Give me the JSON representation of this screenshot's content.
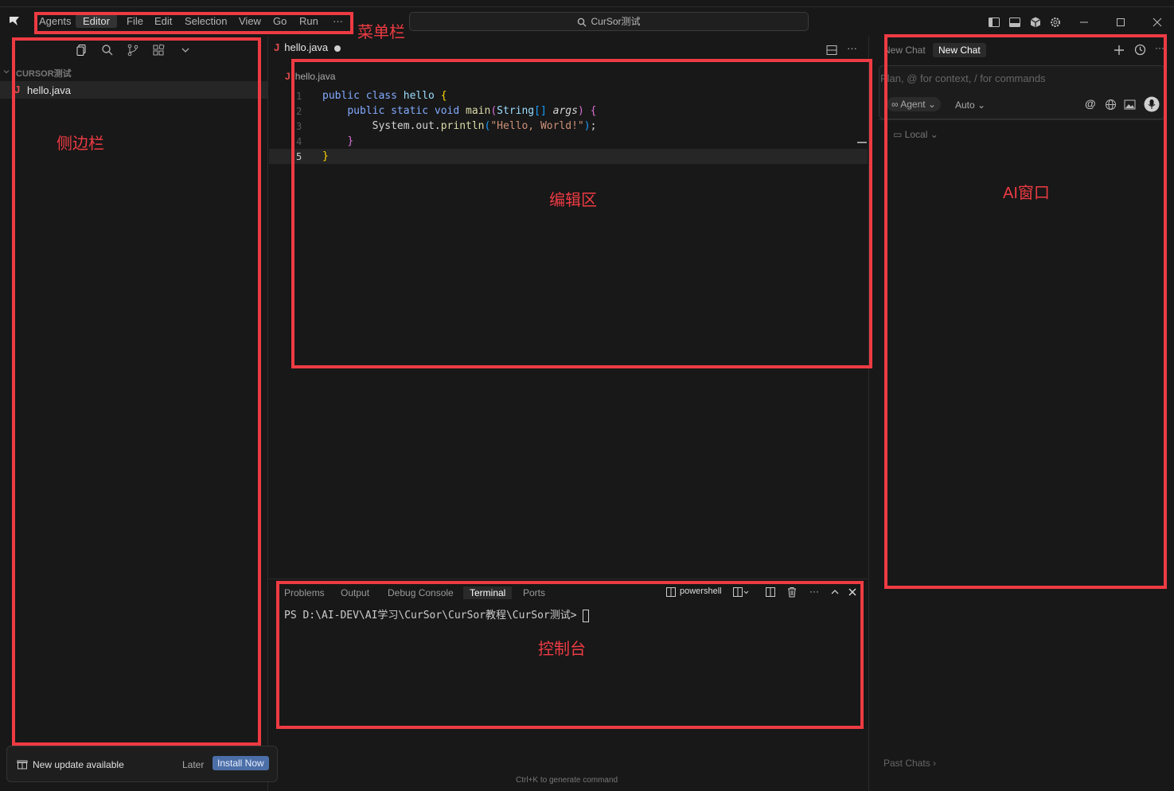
{
  "titlebar": {
    "menu": [
      "Agents",
      "Editor",
      "File",
      "Edit",
      "Selection",
      "View",
      "Go",
      "Run"
    ],
    "more": "···",
    "search_text": "CurSor测试"
  },
  "sidebar": {
    "explorer_title": "CURSOR测试",
    "file_icon_glyph": "J",
    "file_name": "hello.java"
  },
  "editor": {
    "tab_label": "hello.java",
    "breadcrumb": "hello.java",
    "line_numbers": [
      "1",
      "2",
      "3",
      "4",
      "5"
    ]
  },
  "panel": {
    "tabs": [
      "Problems",
      "Output",
      "Debug Console",
      "Terminal",
      "Ports"
    ],
    "shell": "powershell",
    "terminal_prompt": "PS D:\\AI-DEV\\AI学习\\CurSor\\CurSor教程\\CurSor测试> ",
    "hint": "Ctrl+K to generate command"
  },
  "ai": {
    "tab1": "New Chat",
    "tab2": "New Chat",
    "placeholder": "Plan, @ for context, / for commands",
    "agent_label": "Agent",
    "auto_label": "Auto",
    "local_label": "Local",
    "past_chats": "Past Chats"
  },
  "notification": {
    "text": "New update available",
    "later": "Later",
    "install": "Install Now"
  },
  "annotations": {
    "menubar": "菜单栏",
    "sidebar": "侧边栏",
    "editor": "编辑区",
    "ai": "AI窗口",
    "console": "控制台"
  },
  "colors": {
    "annotation": "#ee3b43",
    "background": "#181818",
    "install_button": "#4c6fa8"
  }
}
